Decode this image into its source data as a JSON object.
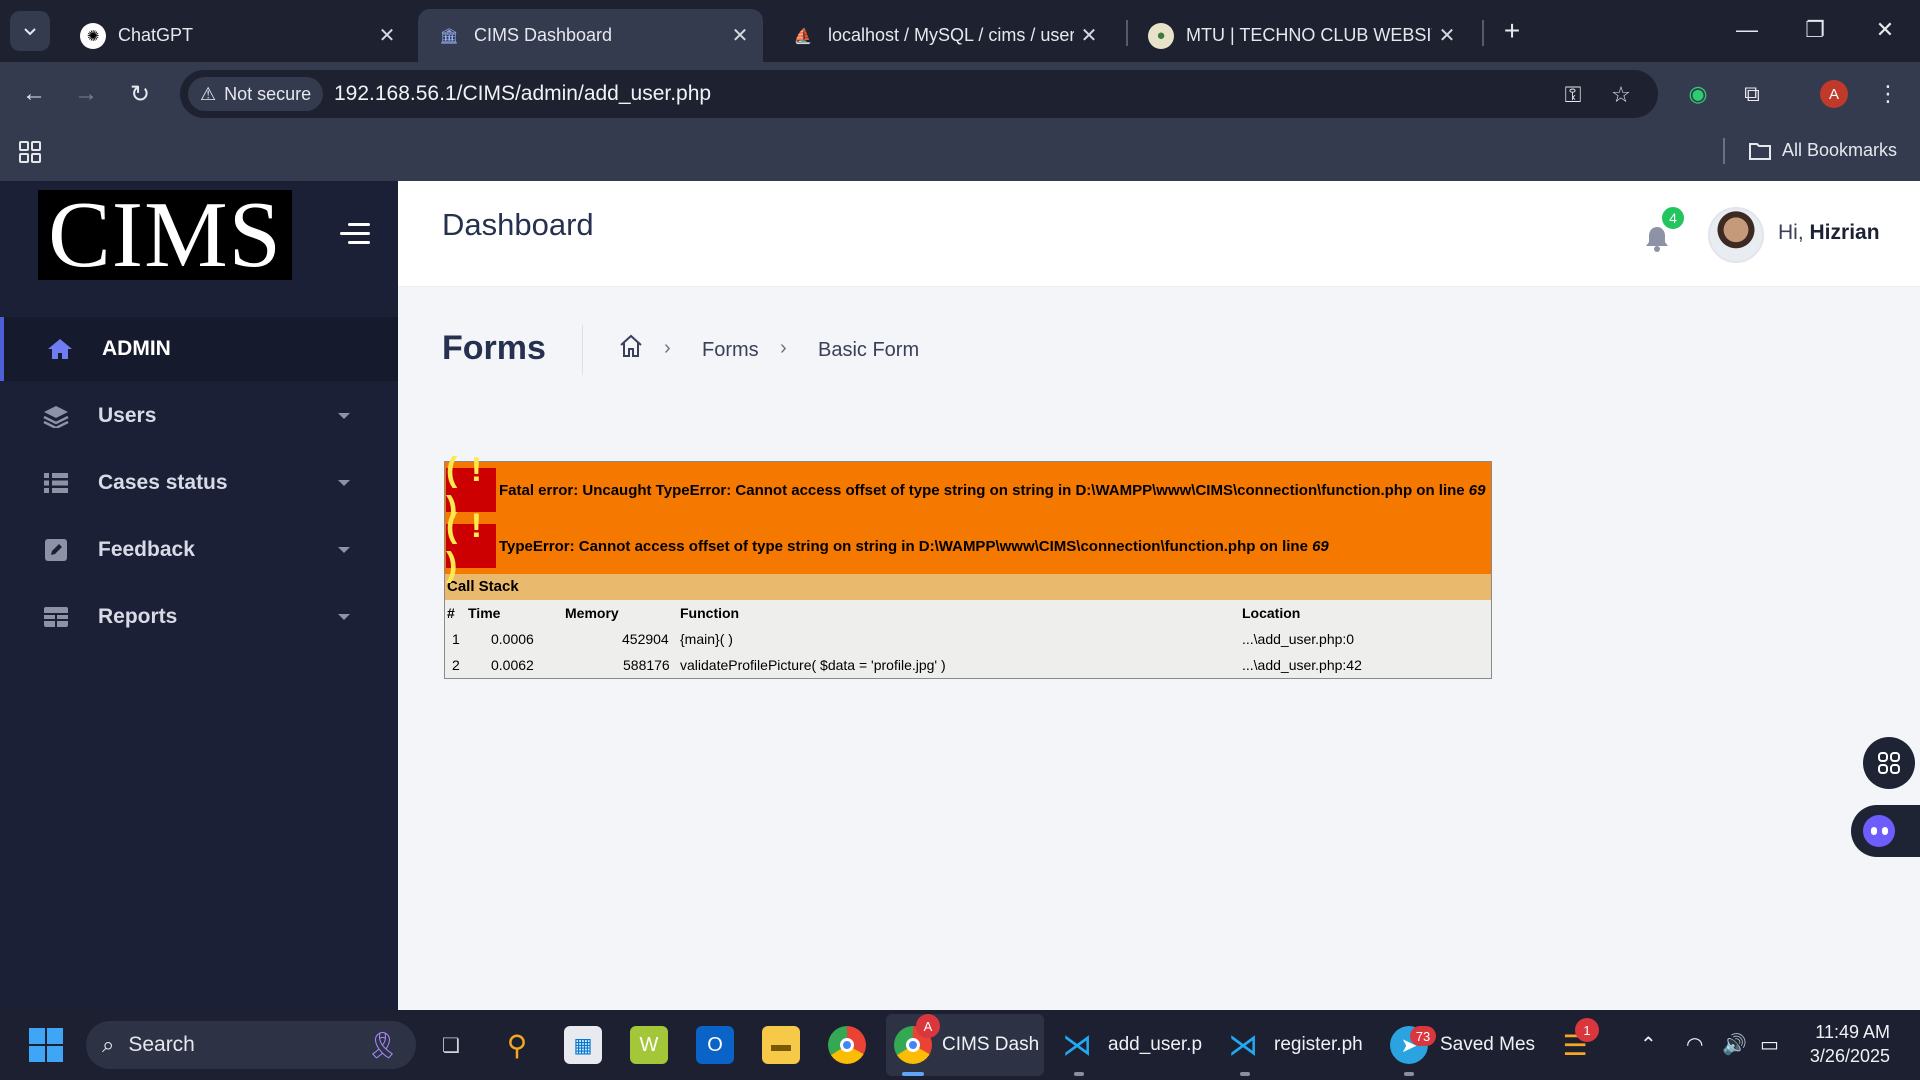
{
  "browser": {
    "tabs": [
      {
        "title": "ChatGPT",
        "icon": "chatgpt-icon"
      },
      {
        "title": "CIMS Dashboard",
        "icon": "bank-icon",
        "active": true
      },
      {
        "title": "localhost / MySQL / cims / user",
        "icon": "phpmyadmin-icon"
      },
      {
        "title": "MTU | TECHNO CLUB WEBSITE",
        "icon": "mtu-logo-icon"
      }
    ],
    "security_label": "Not secure",
    "url": "192.168.56.1/CIMS/admin/add_user.php",
    "profile_initial": "A",
    "all_bookmarks": "All Bookmarks"
  },
  "app": {
    "logo_text": "CIMS",
    "header_title": "Dashboard",
    "notification_count": "4",
    "greeting_prefix": "Hi,",
    "user_name": "Hizrian",
    "sidebar": [
      {
        "label": "ADMIN",
        "icon": "home-icon",
        "active": true
      },
      {
        "label": "Users",
        "icon": "layers-icon"
      },
      {
        "label": "Cases status",
        "icon": "list-icon"
      },
      {
        "label": "Feedback",
        "icon": "edit-icon"
      },
      {
        "label": "Reports",
        "icon": "table-icon"
      }
    ],
    "page_title": "Forms",
    "breadcrumb": [
      "Forms",
      "Basic Form"
    ]
  },
  "error": {
    "bang": "( ! )",
    "fatal_text": "Fatal error: Uncaught TypeError: Cannot access offset of type string on string in D:\\WAMPP\\www\\CIMS\\connection\\function.php on line ",
    "fatal_line": "69",
    "type_text": "TypeError: Cannot access offset of type string on string in D:\\WAMPP\\www\\CIMS\\connection\\function.php on line ",
    "type_line": "69",
    "call_stack_title": "Call Stack",
    "columns": [
      "#",
      "Time",
      "Memory",
      "Function",
      "Location"
    ],
    "rows": [
      [
        "1",
        "0.0006",
        "452904",
        "{main}( )",
        "...\\add_user.php:0"
      ],
      [
        "2",
        "0.0062",
        "588176",
        "validateProfilePicture( $data = 'profile.jpg' )",
        "...\\add_user.php:42"
      ]
    ]
  },
  "taskbar": {
    "search_label": "Search",
    "items": [
      {
        "label": "CIMS Dash",
        "icon": "chrome-icon"
      },
      {
        "label": "add_user.p",
        "icon": "vscode-icon"
      },
      {
        "label": "register.ph",
        "icon": "vscode-icon"
      },
      {
        "label": "Saved Mes",
        "icon": "telegram-icon",
        "badge": "73"
      }
    ],
    "weather_badge": "1",
    "chrome_badge": "A",
    "time": "11:49 AM",
    "date": "3/26/2025"
  }
}
